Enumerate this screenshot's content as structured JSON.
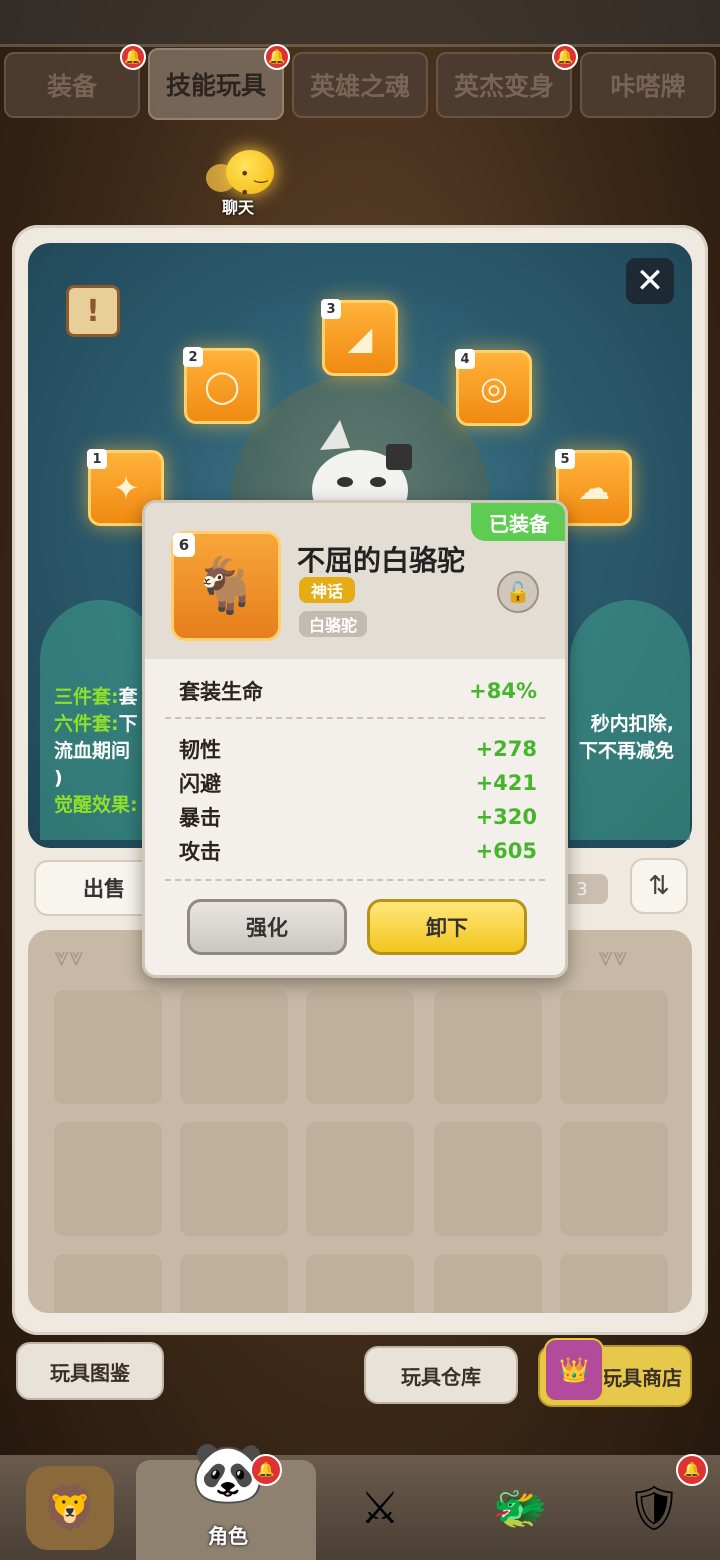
{
  "tabs": [
    {
      "label": "装备",
      "active": false,
      "badge": true
    },
    {
      "label": "技能玩具",
      "active": true,
      "badge": true
    },
    {
      "label": "英雄之魂",
      "active": false,
      "badge": false
    },
    {
      "label": "英杰变身",
      "active": false,
      "badge": true
    },
    {
      "label": "咔嗒牌",
      "active": false,
      "badge": false
    }
  ],
  "chat": {
    "label": "聊天"
  },
  "slots": [
    {
      "num": "1",
      "icon": "claw-icon"
    },
    {
      "num": "2",
      "icon": "ring-icon"
    },
    {
      "num": "3",
      "icon": "horn-icon"
    },
    {
      "num": "4",
      "icon": "bracelet-icon"
    },
    {
      "num": "5",
      "icon": "cotton-icon"
    }
  ],
  "set_info": {
    "three_piece_label": "三件套:",
    "three_piece_text": "套",
    "six_piece_label": "六件套:",
    "six_piece_text_left": "下",
    "six_piece_text_right": "秒内扣除,",
    "bleed_left": "流血期间",
    "bleed_right": "下不再减免",
    "paren": ")",
    "awaken_label": "觉醒效果:"
  },
  "sell_label": "出售",
  "counter_text": "3",
  "bottom": {
    "codex_label": "玩具图鉴",
    "storage_label": "玩具仓库",
    "shop_label": "玩具商店"
  },
  "nav": {
    "active_label": "角色"
  },
  "popup": {
    "equipped_label": "已装备",
    "item_num": "6",
    "item_name": "不屈的白骆驼",
    "rarity": "神话",
    "type": "白骆驼",
    "set_stat": {
      "name": "套装生命",
      "value": "+84%"
    },
    "stats": [
      {
        "name": "韧性",
        "value": "+278"
      },
      {
        "name": "闪避",
        "value": "+421"
      },
      {
        "name": "暴击",
        "value": "+320"
      },
      {
        "name": "攻击",
        "value": "+605"
      }
    ],
    "enhance_label": "强化",
    "unequip_label": "卸下"
  },
  "colors": {
    "accent_green": "#46b52b",
    "equipped_green": "#5ecb53",
    "slot_orange": "#f08a12",
    "rarity_gold": "#e5ac15"
  }
}
